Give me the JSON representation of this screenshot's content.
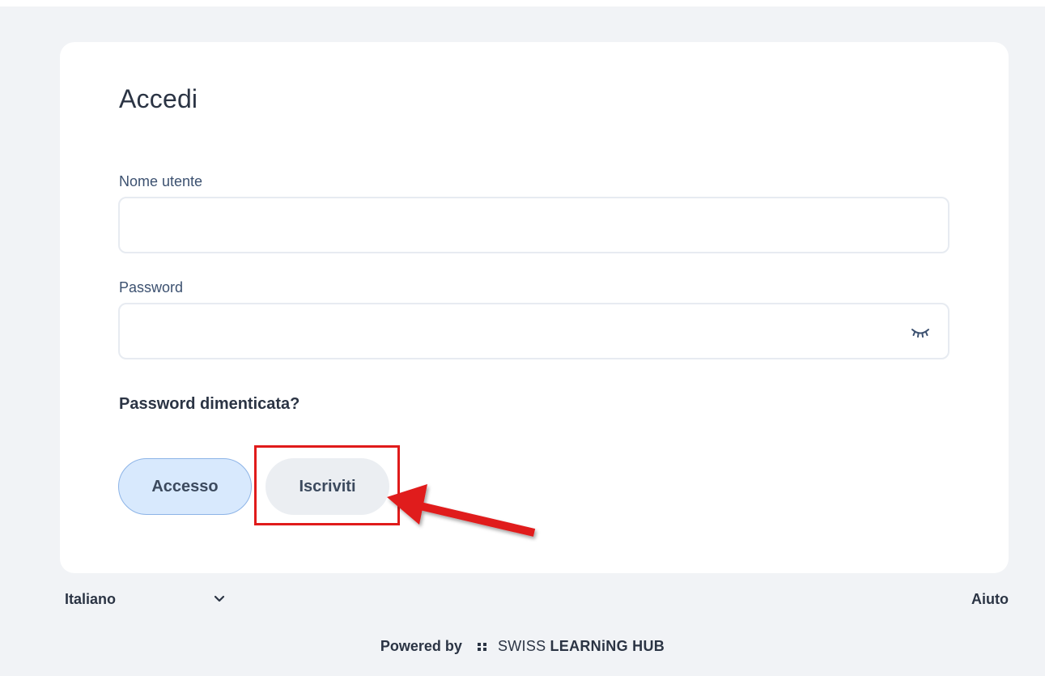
{
  "login": {
    "title": "Accedi",
    "username_label": "Nome utente",
    "username_value": "",
    "password_label": "Password",
    "password_value": "",
    "forgot_link": "Password dimenticata?",
    "login_button": "Accesso",
    "signup_button": "Iscriviti"
  },
  "footer": {
    "language": "Italiano",
    "help": "Aiuto",
    "powered_by": "Powered by",
    "brand_light": "SWISS",
    "brand_bold": "LEARNiNG HUB"
  },
  "icons": {
    "password_toggle": "eye-closed-icon",
    "language_toggle": "chevron-down-icon",
    "brand_mark": "brand-dots-icon",
    "annotation_arrow": "red-arrow-icon"
  },
  "colors": {
    "background": "#f1f3f6",
    "card": "#ffffff",
    "text": "#2b3444",
    "label": "#3c5170",
    "primary_button": "#d8e9fd",
    "primary_button_border": "#8db4e7",
    "secondary_button": "#ebeef2",
    "annotation": "#e01b1b"
  }
}
